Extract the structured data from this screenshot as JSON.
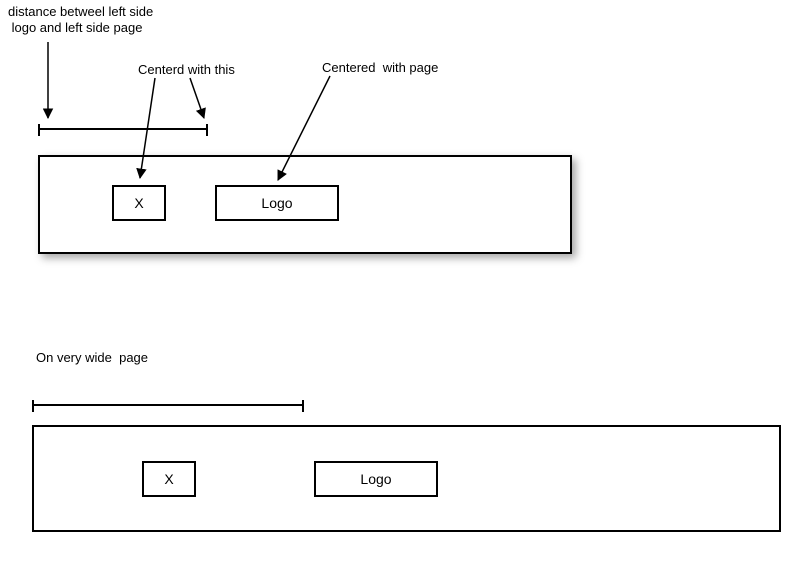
{
  "annotations": {
    "leftGapLabel": "distance betweel left side\n logo and left side page",
    "centeredWithLabel": "Centerd with this",
    "centeredPageLabel": "Centered  with page",
    "wideCaption": "On very wide  page"
  },
  "page1": {
    "xLabel": "X",
    "logoLabel": "Logo"
  },
  "page2": {
    "xLabel": "X",
    "logoLabel": "Logo"
  }
}
